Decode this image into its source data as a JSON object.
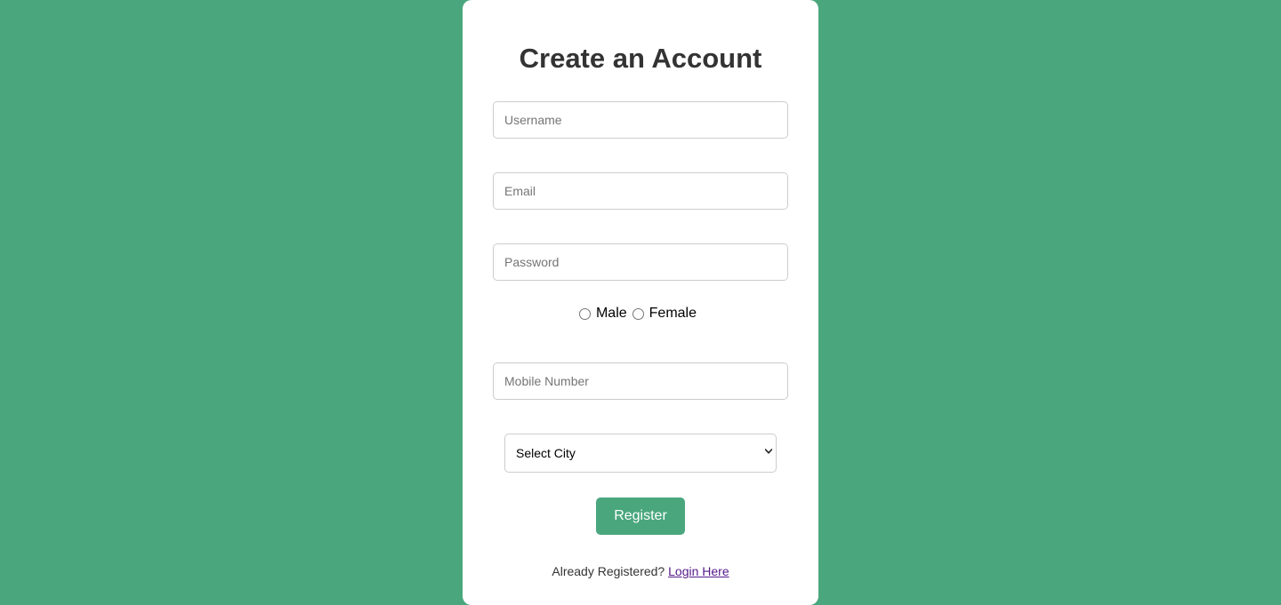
{
  "form": {
    "title": "Create an Account",
    "username_placeholder": "Username",
    "email_placeholder": "Email",
    "password_placeholder": "Password",
    "gender_options": [
      "Male",
      "Female"
    ],
    "mobile_placeholder": "Mobile Number",
    "city_selected": "Select City",
    "register_label": "Register",
    "footer_text": "Already Registered?",
    "login_link": "Login Here"
  },
  "colors": {
    "background": "#4aa77d",
    "card": "#ffffff",
    "button": "#4aa77d",
    "link": "#551a8b"
  }
}
